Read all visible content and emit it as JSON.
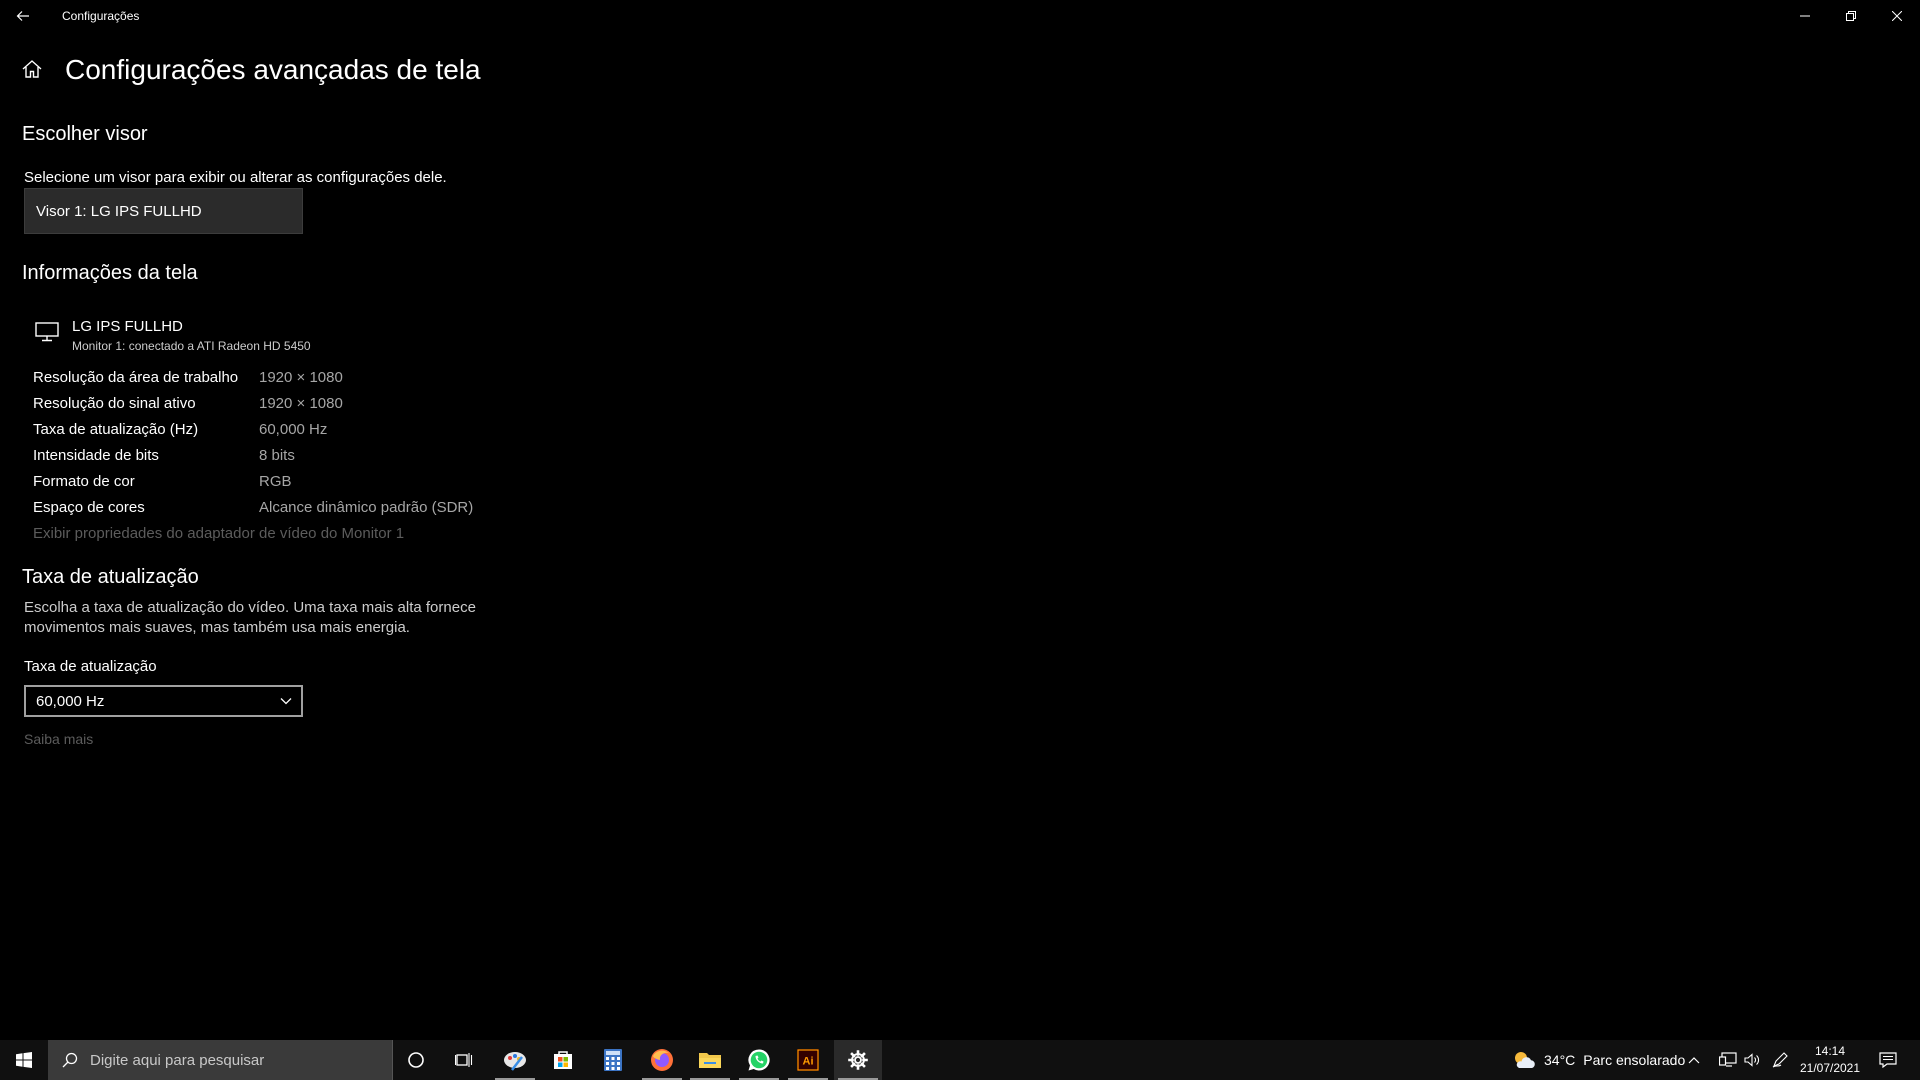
{
  "window": {
    "title": "Configurações",
    "minimize_glyph": "—",
    "restore_glyph": "❐",
    "close_glyph": "✕"
  },
  "page": {
    "title": "Configurações avançadas de tela"
  },
  "choose_display": {
    "heading": "Escolher visor",
    "description": "Selecione um visor para exibir ou alterar as configurações dele.",
    "selected": "Visor 1: LG IPS FULLHD"
  },
  "display_info": {
    "heading": "Informações da tela",
    "monitor_name": "LG IPS FULLHD",
    "monitor_sub": "Monitor 1: conectado a ATI Radeon HD 5450",
    "rows": [
      {
        "label": "Resolução da área de trabalho",
        "value": "1920 × 1080"
      },
      {
        "label": "Resolução do sinal ativo",
        "value": "1920 × 1080"
      },
      {
        "label": "Taxa de atualização (Hz)",
        "value": "60,000 Hz"
      },
      {
        "label": "Intensidade de bits",
        "value": "8 bits"
      },
      {
        "label": "Formato de cor",
        "value": "RGB"
      },
      {
        "label": "Espaço de cores",
        "value": "Alcance dinâmico padrão (SDR)"
      }
    ],
    "adapter_link": "Exibir propriedades do adaptador de vídeo do Monitor 1"
  },
  "refresh_rate": {
    "heading": "Taxa de atualização",
    "description": "Escolha a taxa de atualização do vídeo. Uma taxa mais alta fornece movimentos mais suaves, mas também usa mais energia.",
    "field_label": "Taxa de atualização",
    "selected": "60,000 Hz",
    "learn_more": "Saiba mais"
  },
  "taskbar": {
    "search_placeholder": "Digite aqui para pesquisar",
    "apps": [
      "cortana-icon",
      "task-view-icon",
      "paint-app-icon",
      "store-icon",
      "calculator-icon",
      "firefox-icon",
      "file-explorer-icon",
      "whatsapp-icon",
      "illustrator-icon",
      "settings-icon"
    ],
    "illustrator_label": "Ai",
    "weather_temp": "34°C",
    "weather_text": "Parc ensolarado",
    "time": "14:14",
    "date": "21/07/2021"
  },
  "colors": {
    "background": "#000000",
    "taskbar": "#101010",
    "muted_text": "#a6a6a6",
    "disabled_text": "#5c5c5c"
  }
}
